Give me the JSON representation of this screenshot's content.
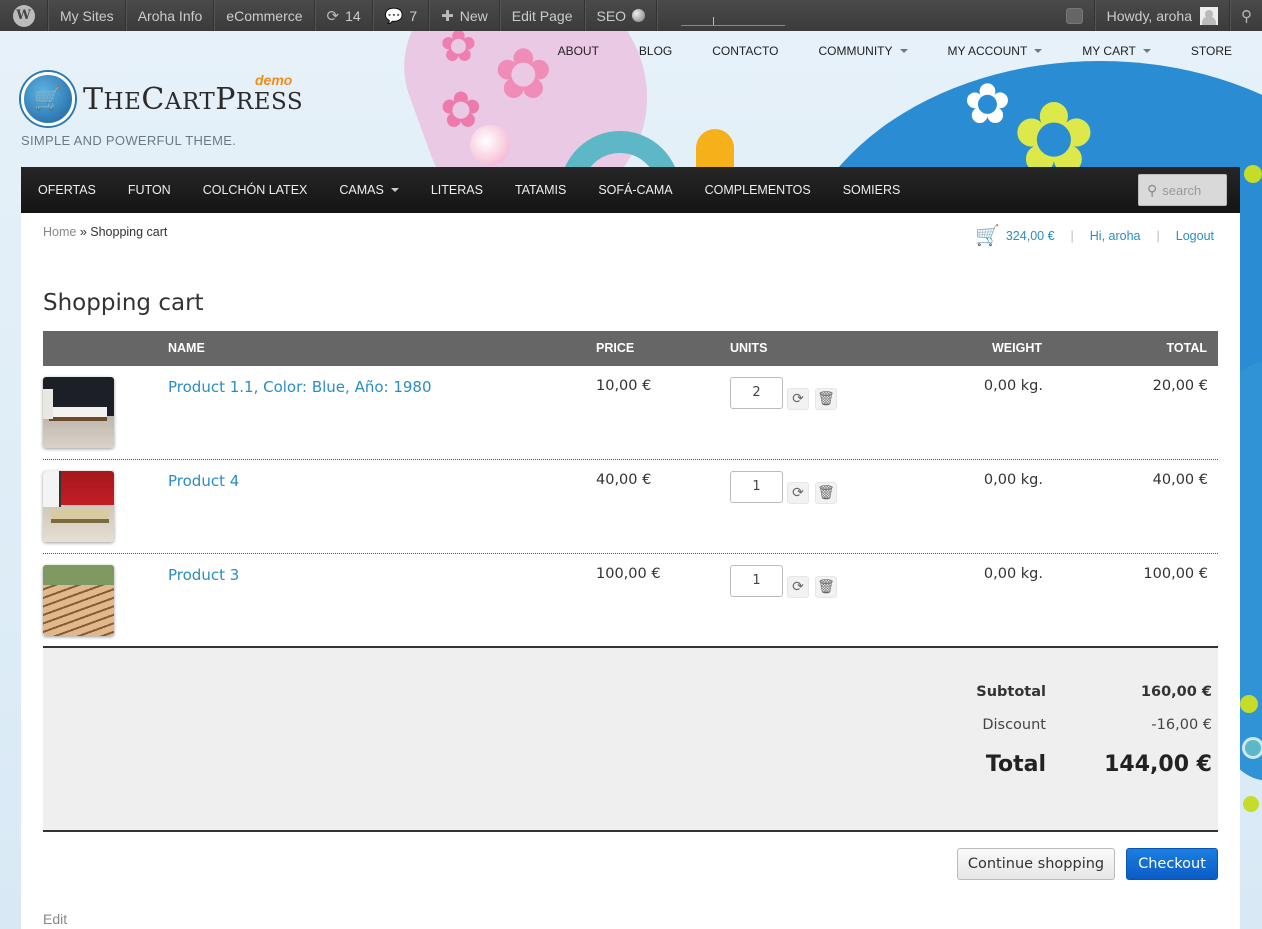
{
  "adminbar": {
    "my_sites": "My Sites",
    "site_name": "Aroha Info",
    "ecommerce": "eCommerce",
    "updates_count": "14",
    "comments_count": "7",
    "new": "New",
    "edit_page": "Edit Page",
    "seo": "SEO",
    "howdy": "Howdy, aroha"
  },
  "header": {
    "logo_demo": "demo",
    "tagline": "SIMPLE AND POWERFUL THEME."
  },
  "topnav": [
    "ABOUT",
    "BLOG",
    "CONTACTO",
    "COMMUNITY",
    "MY ACCOUNT",
    "MY CART",
    "STORE"
  ],
  "mainnav": [
    "OFERTAS",
    "FUTON",
    "COLCHÓN LATEX",
    "CAMAS",
    "LITERAS",
    "TATAMIS",
    "SOFÁ-CAMA",
    "COMPLEMENTOS",
    "SOMIERS"
  ],
  "search": {
    "placeholder": "search"
  },
  "breadcrumb": {
    "home": "Home",
    "sep": " » ",
    "current": "Shopping cart"
  },
  "userbar": {
    "cart_total": "324,00 €",
    "hi": "Hi, aroha",
    "logout": "Logout"
  },
  "page_title": "Shopping cart",
  "table": {
    "headers": {
      "name": "NAME",
      "price": "PRICE",
      "units": "UNITS",
      "weight": "WEIGHT",
      "total": "TOTAL"
    },
    "rows": [
      {
        "name": "Product 1.1, Color: Blue, Año: 1980",
        "price": "10,00 €",
        "units": "2",
        "weight": "0,00 kg.",
        "total": "20,00 €"
      },
      {
        "name": "Product 4",
        "price": "40,00 €",
        "units": "1",
        "weight": "0,00 kg.",
        "total": "40,00 €"
      },
      {
        "name": "Product 3",
        "price": "100,00 €",
        "units": "1",
        "weight": "0,00 kg.",
        "total": "100,00 €"
      }
    ]
  },
  "totals": {
    "subtotal_label": "Subtotal",
    "subtotal": "160,00 €",
    "discount_label": "Discount",
    "discount": "-16,00 €",
    "total_label": "Total",
    "total": "144,00 €"
  },
  "buttons": {
    "continue": "Continue shopping",
    "checkout": "Checkout"
  },
  "edit": "Edit",
  "colors": {
    "link": "#2a8dc5",
    "checkout": "#0b5cc4",
    "adminbar": "#464646",
    "nav": "#1c1c1c",
    "demo": "#f08c1a"
  }
}
